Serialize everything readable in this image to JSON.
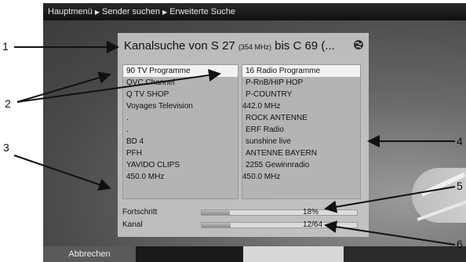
{
  "breadcrumb": [
    "Hauptmenü",
    "Sender suchen",
    "Erweiterte Suche"
  ],
  "dialog": {
    "title_main": "Kanalsuche von S 27 ",
    "title_small": "(354 MHz)",
    "title_end": " bis C 69 (...",
    "globe_icon": "globe-icon"
  },
  "tv": {
    "header": "90 TV Programme",
    "items": [
      "QVC Channel",
      "Q TV SHOP",
      "Voyages Television",
      ".",
      ".",
      "BD 4",
      "PFH",
      "YAVIDO CLIPS",
      "450.0 MHz"
    ]
  },
  "radio": {
    "header": "16 Radio Programme",
    "items": [
      "P-RnB/HIP HOP",
      "P-COUNTRY",
      "442.0 MHz",
      "ROCK ANTENNE",
      "ERF Radio",
      "sunshine live",
      "ANTENNE BAYERN",
      "2255 Gewinnradio",
      "450.0 MHz"
    ]
  },
  "progress": {
    "fortschritt_label": "Fortschritt",
    "fortschritt_value": "18%",
    "fortschritt_fraction": 0.18,
    "kanal_label": "Kanal",
    "kanal_value": "12/64",
    "kanal_fraction": 0.1875
  },
  "footer": {
    "abort_label": "Abbrechen"
  },
  "callouts": [
    "1",
    "2",
    "3",
    "4",
    "5",
    "6"
  ]
}
